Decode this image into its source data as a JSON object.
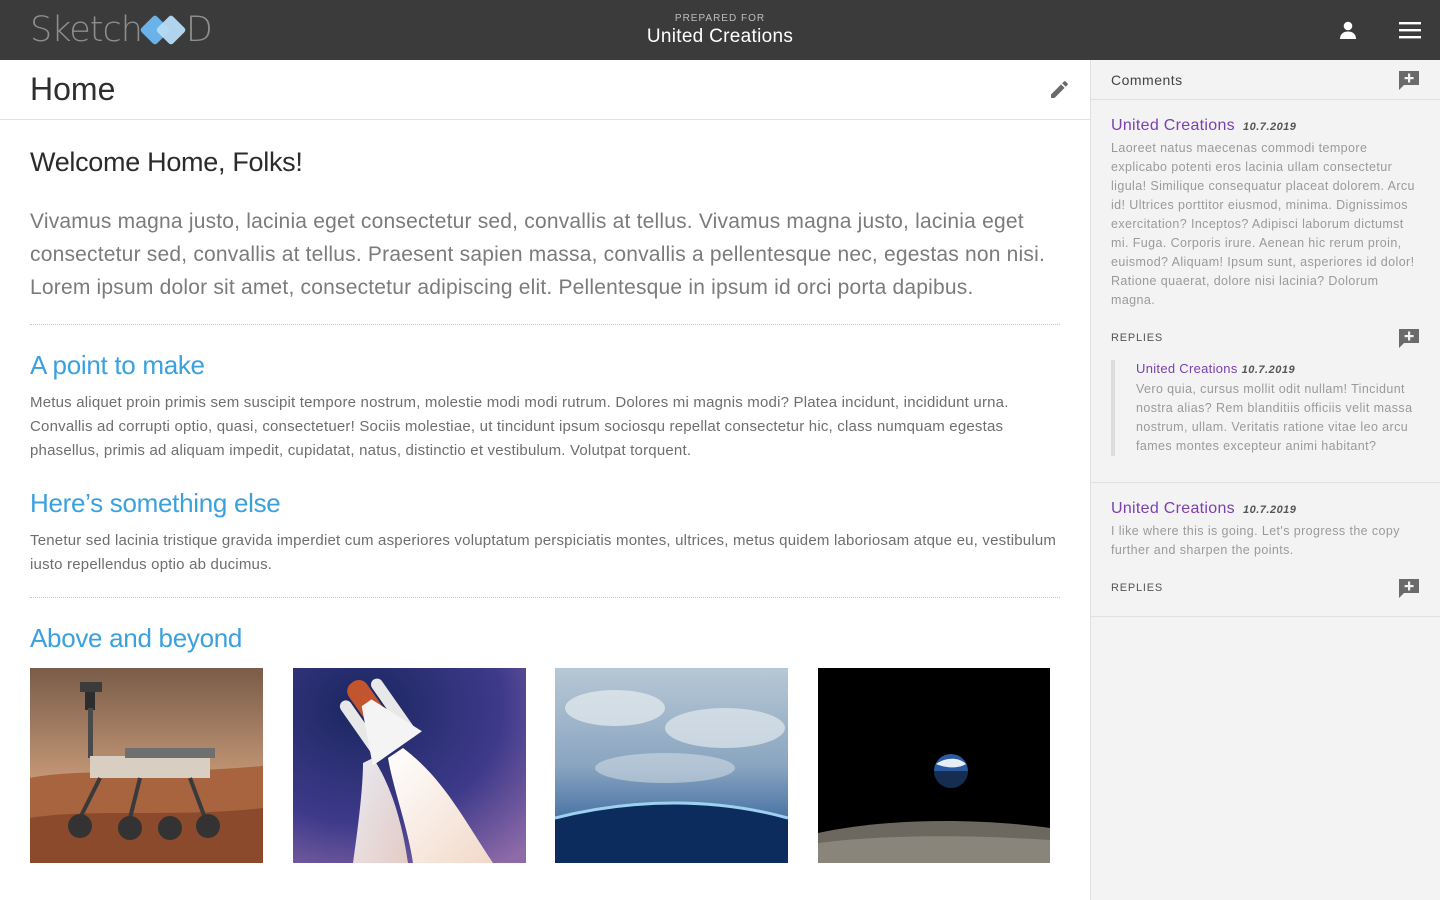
{
  "header": {
    "logo_left": "Sketch",
    "logo_right": "D",
    "prepared_for_label": "PREPARED FOR",
    "client_name": "United Creations",
    "icons": [
      "user-icon",
      "hamburger-menu-icon"
    ]
  },
  "page": {
    "title": "Home",
    "edit_icon": "pencil-icon",
    "welcome_heading": "Welcome Home, Folks!",
    "lead": "Vivamus magna justo, lacinia eget consectetur sed, convallis at tellus. Vivamus magna justo, lacinia eget consectetur sed, convallis at tellus. Praesent sapien massa, convallis a pellentesque nec, egestas non nisi. Lorem ipsum dolor sit amet, consectetur adipiscing elit. Pellentesque in ipsum id orci porta dapibus.",
    "sections": [
      {
        "heading": "A point to make",
        "text": "Metus aliquet proin primis sem suscipit tempore nostrum, molestie modi modi rutrum. Dolores mi magnis modi? Platea incidunt, incididunt urna. Convallis ad corrupti optio, quasi, consectetuer! Sociis molestiae, ut tincidunt ipsum sociosqu repellat consectetur hic, class numquam egestas phasellus, primis ad aliquam impedit, cupidatat, natus, distinctio et vestibulum. Volutpat torquent."
      },
      {
        "heading": "Here’s something else",
        "text": "Tenetur sed lacinia tristique gravida imperdiet cum asperiores voluptatum perspiciatis montes, ultrices, metus quidem laboriosam atque eu, vestibulum iusto repellendus optio ab ducimus."
      }
    ],
    "gallery_heading": "Above and beyond",
    "gallery": [
      "mars-rover-photo",
      "space-shuttle-launch-photo",
      "earth-from-orbit-photo",
      "earthrise-photo"
    ]
  },
  "colors": {
    "topbar": "#3b3b3b",
    "accent_blue": "#3aa1dd",
    "author_purple": "#7b3fb0",
    "sidebar_bg": "#f3f3f3"
  },
  "comments": {
    "title": "Comments",
    "add_icon": "add-comment-icon",
    "items": [
      {
        "author": "United Creations",
        "date": "10.7.2019",
        "text": "Laoreet natus maecenas commodi tempore explicabo potenti eros lacinia ullam consectetur ligula! Similique consequatur placeat dolorem. Arcu id! Ultrices porttitor eiusmod, minima. Dignissimos exercitation? Inceptos? Adipisci laborum dictumst mi. Fuga. Corporis irure. Aenean hic rerum proin, euismod? Aliquam! Ipsum sunt, asperiores id dolor! Ratione quaerat, dolore nisi lacinia? Dolorum magna.",
        "replies_label": "REPLIES",
        "replies": [
          {
            "author": "United Creations",
            "date": "10.7.2019",
            "text": "Vero quia, cursus mollit odit nullam! Tincidunt nostra alias? Rem blanditiis officiis velit massa nostrum, ullam. Veritatis ratione vitae leo arcu fames montes excepteur animi habitant?"
          }
        ]
      },
      {
        "author": "United Creations",
        "date": "10.7.2019",
        "text": "I like where this is going. Let's progress the copy further and sharpen the points.",
        "replies_label": "REPLIES",
        "replies": []
      }
    ]
  }
}
